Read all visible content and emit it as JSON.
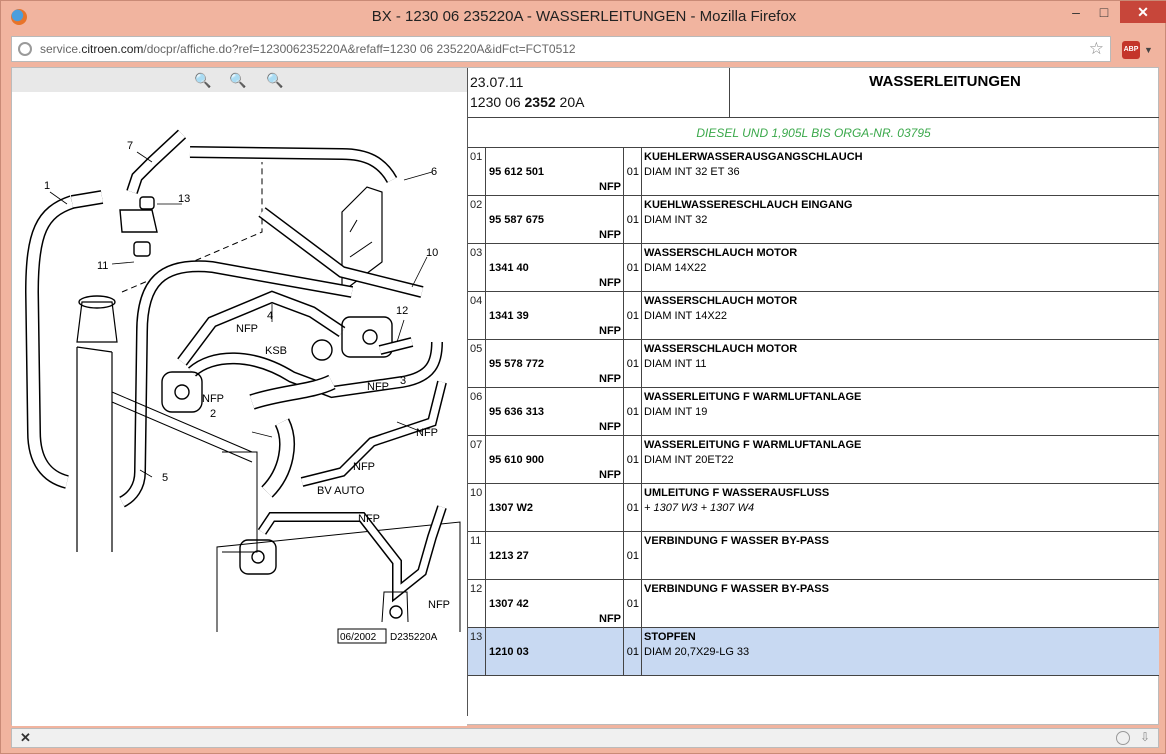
{
  "window": {
    "title": "BX - 1230 06 235220A - WASSERLEITUNGEN - Mozilla Firefox",
    "min": "–",
    "max": "□",
    "close": "✕"
  },
  "browser": {
    "url_domain": "service.citroen.com",
    "url_rest": "/docpr/affiche.do?ref=123006235220A&refaff=1230 06 235220A&idFct=FCT0512",
    "url_prefix": "service.",
    "url_host": "citroen.com",
    "abp": "ABP"
  },
  "diagram": {
    "labels": {
      "n1": "1",
      "n2": "2",
      "n3": "3",
      "n4": "4",
      "n5": "5",
      "n6": "6",
      "n7": "7",
      "n10": "10",
      "n11": "11",
      "n12": "12",
      "n13": "13",
      "nfp": "NFP",
      "ksb": "KSB",
      "bv_auto": "BV AUTO",
      "date": "06/2002",
      "code": "D235220A"
    }
  },
  "header": {
    "date": "23.07.11",
    "ref_pre": "1230 06 ",
    "ref_bold": "2352",
    "ref_post": " 20A",
    "title": "WASSERLEITUNGEN",
    "subtitle": "DIESEL UND 1,905L BIS ORGA-NR. 03795"
  },
  "rows": [
    {
      "num": "01",
      "ref": "95 612 501",
      "nfp": "NFP",
      "qty": "01",
      "name": "KUEHLERWASSERAUSGANGSCHLAUCH",
      "detail": "DIAM INT 32 ET 36"
    },
    {
      "num": "02",
      "ref": "95 587 675",
      "nfp": "NFP",
      "qty": "01",
      "name": "KUEHLWASSERESCHLAUCH EINGANG",
      "detail": "DIAM INT 32"
    },
    {
      "num": "03",
      "ref": "1341 40",
      "nfp": "NFP",
      "qty": "01",
      "name": "WASSERSCHLAUCH MOTOR",
      "detail": "DIAM 14X22"
    },
    {
      "num": "04",
      "ref": "1341 39",
      "nfp": "NFP",
      "qty": "01",
      "name": "WASSERSCHLAUCH MOTOR",
      "detail": "DIAM INT 14X22"
    },
    {
      "num": "05",
      "ref": "95 578 772",
      "nfp": "NFP",
      "qty": "01",
      "name": "WASSERSCHLAUCH MOTOR",
      "detail": "DIAM INT 11"
    },
    {
      "num": "06",
      "ref": "95 636 313",
      "nfp": "NFP",
      "qty": "01",
      "name": "WASSERLEITUNG F WARMLUFTANLAGE",
      "detail": "DIAM INT 19"
    },
    {
      "num": "07",
      "ref": "95 610 900",
      "nfp": "NFP",
      "qty": "01",
      "name": "WASSERLEITUNG F WARMLUFTANLAGE",
      "detail": "DIAM INT 20ET22"
    },
    {
      "num": "10",
      "ref": "1307 W2",
      "nfp": "",
      "qty": "01",
      "name": "UMLEITUNG F WASSERAUSFLUSS",
      "detail": "+ 1307 W3 + 1307 W4"
    },
    {
      "num": "11",
      "ref": "1213 27",
      "nfp": "",
      "qty": "01",
      "name": "VERBINDUNG F WASSER BY-PASS",
      "detail": ""
    },
    {
      "num": "12",
      "ref": "1307 42",
      "nfp": "NFP",
      "qty": "01",
      "name": "VERBINDUNG F WASSER BY-PASS",
      "detail": ""
    },
    {
      "num": "13",
      "ref": "1210 03",
      "nfp": "",
      "qty": "01",
      "name": "STOPFEN",
      "detail": "DIAM 20,7X29-LG 33"
    }
  ],
  "statusbar": {
    "close": "✕"
  }
}
